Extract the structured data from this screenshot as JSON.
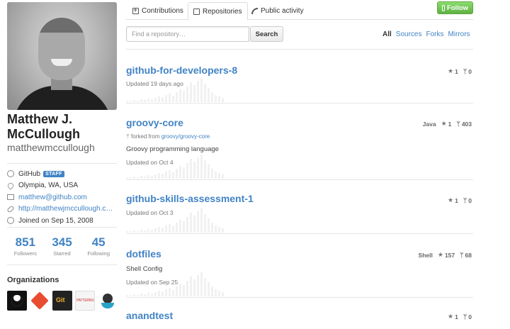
{
  "profile": {
    "fullname_line1": "Matthew J.",
    "fullname_line2": "McCullough",
    "username": "matthewmccullough",
    "company": "GitHub",
    "staff_badge": "STAFF",
    "location": "Olympia, WA, USA",
    "email": "matthew@github.com",
    "website": "http://matthewjmccullough.co...",
    "joined": "Joined on Sep 15, 2008"
  },
  "stats": [
    {
      "num": "851",
      "label": "Followers"
    },
    {
      "num": "345",
      "label": "Starred"
    },
    {
      "num": "45",
      "label": "Following"
    }
  ],
  "orgs": {
    "title": "Organizations",
    "items": [
      {
        "icon": "github-org-icon"
      },
      {
        "icon": "git-org-icon"
      },
      {
        "icon": "pro-git-org-icon",
        "text": "Git"
      },
      {
        "icon": "patterns-org-icon",
        "text": "PATTERNS"
      },
      {
        "icon": "octocat-org-icon"
      }
    ]
  },
  "tabs": {
    "contributions": "Contributions",
    "repositories": "Repositories",
    "activity": "Public activity"
  },
  "follow_label": "Follow",
  "search": {
    "placeholder": "Find a repository…",
    "button": "Search"
  },
  "filters": {
    "all": "All",
    "sources": "Sources",
    "forks": "Forks",
    "mirrors": "Mirrors"
  },
  "repos": [
    {
      "name": "github-for-developers-8",
      "updated": "Updated 19 days ago",
      "stars": "1",
      "forks": "0"
    },
    {
      "name": "groovy-core",
      "fork_prefix": "forked from ",
      "fork_source": "groovy/groovy-core",
      "description": "Groovy programming language",
      "updated": "Updated on Oct 4",
      "language": "Java",
      "stars": "1",
      "forks": "403"
    },
    {
      "name": "github-skills-assessment-1",
      "updated": "Updated on Oct 3",
      "stars": "1",
      "forks": "0"
    },
    {
      "name": "dotfiles",
      "description": "Shell Config",
      "updated": "Updated on Sep 25",
      "language": "Shell",
      "stars": "157",
      "forks": "68"
    },
    {
      "name": "anandtest",
      "stars": "1",
      "forks": "0"
    }
  ],
  "colors": {
    "link": "#4183c4",
    "follow_button": "#6cc644",
    "staff_badge": "#4183c4"
  }
}
